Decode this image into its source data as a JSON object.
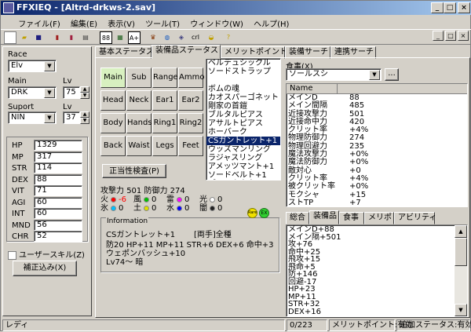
{
  "window": {
    "title": "FFXIEQ - [Altrd-drkws-2.sav]"
  },
  "titlebar": {
    "minimize": "_",
    "maximize": "□",
    "close": "×"
  },
  "menu": [
    "ファイル(F)",
    "編集(E)",
    "表示(V)",
    "ツール(T)",
    "ウィンドウ(W)",
    "ヘルプ(H)"
  ],
  "toolbar": {
    "buttons": [
      "new-icon",
      "open-icon",
      "save-icon",
      "book-icon",
      "book2-icon",
      "print-icon",
      "88",
      "grid",
      "A+",
      "mage-icon",
      "globe-icon",
      "cube-icon",
      "crl",
      "hat-icon",
      "hint-icon"
    ]
  },
  "left": {
    "race_label": "Race",
    "race": "Elv",
    "main_label": "Main",
    "main": "DRK",
    "lv_label": "Lv",
    "main_lv": "75",
    "sup_label": "Suport",
    "sup": "NIN",
    "sup_lv_label": "Lv",
    "sup_lv": "37",
    "stats": [
      {
        "k": "HP",
        "v": "1329"
      },
      {
        "k": "MP",
        "v": "317"
      },
      {
        "k": "STR",
        "v": "114"
      },
      {
        "k": "DEX",
        "v": "88"
      },
      {
        "k": "VIT",
        "v": "71"
      },
      {
        "k": "AGI",
        "v": "60"
      },
      {
        "k": "INT",
        "v": "60"
      },
      {
        "k": "MND",
        "v": "56"
      },
      {
        "k": "CHR",
        "v": "52"
      }
    ],
    "user_skill": "ユーザースキル(Z)",
    "correction": "補正込み(X)"
  },
  "tabs": [
    "基本ステータス",
    "装備品ステータス",
    "メリットポイント",
    "装備サーチ",
    "連携サーチ"
  ],
  "slots": [
    "Main",
    "Sub",
    "Range",
    "Ammo",
    "Head",
    "Neck",
    "Ear1",
    "Ear2",
    "Body",
    "Hands",
    "Ring1",
    "Ring2",
    "Back",
    "Waist",
    "Legs",
    "Feet"
  ],
  "check_button": "正当性検査(P)",
  "equip_list": [
    "ベルデュシックル",
    "ソードストラップ",
    "",
    "ボムの魂",
    "カオスパーゴネット",
    "剛家の首鎧",
    "ブルタルピアス",
    "アサルトピアス",
    "ホーバーク",
    "CSガントレット+1",
    "ウッズマンリング",
    "ラジャスリング",
    "アメッツマント+1",
    "ソードベルト+1",
    "ブラックウウィス",
    "ブラックソルレット"
  ],
  "equip_selected": "CSガントレット+1",
  "attack": {
    "atk_label": "攻撃力",
    "atk": "501",
    "def_label": "防御力",
    "def": "274"
  },
  "elements": [
    {
      "name": "火",
      "color": "#ff0000",
      "v": "-6"
    },
    {
      "name": "風",
      "color": "#00c000",
      "v": "0"
    },
    {
      "name": "雷",
      "color": "#ff00ff",
      "v": "0"
    },
    {
      "name": "光",
      "color": "#ffffff",
      "v": "0"
    },
    {
      "name": "氷",
      "color": "#00c0ff",
      "v": "0"
    },
    {
      "name": "土",
      "color": "#e0e000",
      "v": "0"
    },
    {
      "name": "水",
      "color": "#0000ff",
      "v": "0"
    },
    {
      "name": "闇",
      "color": "#202020",
      "v": "0"
    }
  ],
  "info": {
    "legend": "Information",
    "name": "CSガントレット+1",
    "type": "[両手]全種",
    "line1": "防20 HP+11 MP+11 STR+6 DEX+6 命中+3",
    "line2": "ウェポンバッシュ+10",
    "line3": "Lv74～ 暗",
    "badge_rare": "Rare",
    "badge_ex": "EX"
  },
  "food": {
    "label": "食事(X)",
    "value": "ソールスシ",
    "btn": "..."
  },
  "stat_table": {
    "header": "Name",
    "rows": [
      {
        "k": "メインD",
        "v": "88"
      },
      {
        "k": "メイン間隔",
        "v": "485"
      },
      {
        "k": "近接攻撃力",
        "v": "501"
      },
      {
        "k": "近接命中力",
        "v": "420"
      },
      {
        "k": "クリット率",
        "v": "+4%"
      },
      {
        "k": "物理防御力",
        "v": "274"
      },
      {
        "k": "物理回避力",
        "v": "235"
      },
      {
        "k": "魔法攻撃力",
        "v": "+0%"
      },
      {
        "k": "魔法防御力",
        "v": "+0%"
      },
      {
        "k": "敵対心",
        "v": "+0"
      },
      {
        "k": "クリット率",
        "v": "+4%"
      },
      {
        "k": "被クリット率",
        "v": "+0%"
      },
      {
        "k": "モクシャ",
        "v": "+15"
      },
      {
        "k": "ストTP",
        "v": "+7"
      }
    ]
  },
  "bottom_tabs": [
    "総合",
    "装備品",
    "食事",
    "メリポ",
    "アビリティ"
  ],
  "totals": [
    "メインD+88",
    "メイン隔+501",
    "攻+76",
    "命中+25",
    "飛攻+15",
    "飛命+5",
    "防+146",
    "回避-17",
    "HP+23",
    "MP+11",
    "STR+32",
    "DEX+16"
  ],
  "status": {
    "ready": "レディ",
    "count": "0/223",
    "merit": "メリットポイント:有効",
    "extra": "追加ステータス:有効"
  }
}
